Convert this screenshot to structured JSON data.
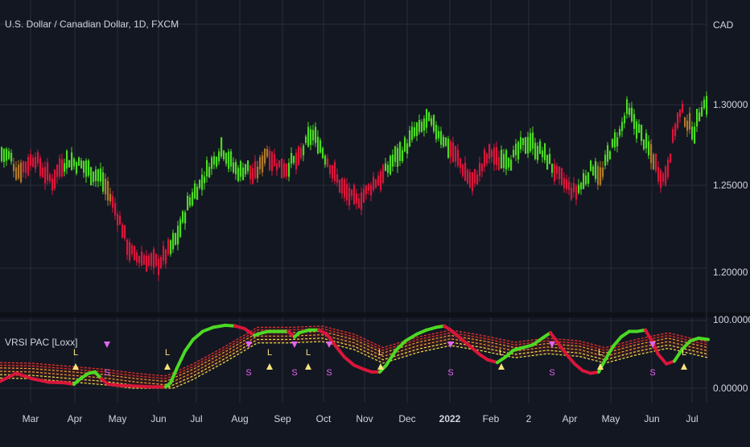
{
  "header": {
    "title": "U.S. Dollar / Canadian Dollar, 1D, FXCM",
    "indicator_name": "VRSI PAC [Loxx]",
    "currency_label": "CAD"
  },
  "colors": {
    "background": "#131722",
    "grid": "#2a2e39",
    "bull": "#4cd924",
    "bear": "#d9163a",
    "neutral": "#b07828",
    "band_upper": "#e3342f",
    "band_mid": "#f0a030",
    "band_lower": "#e6e64a",
    "buy_marker": "#f7e37a",
    "sell_marker": "#e066f0"
  },
  "chart_data": [
    {
      "type": "candlestick",
      "symbol": "USD/CAD",
      "interval": "1D",
      "y_ticks": [
        "1.30000",
        "1.25000",
        "1.20000"
      ],
      "ylim": [
        1.175,
        1.325
      ],
      "x_ticks": [
        "Mar",
        "Apr",
        "May",
        "Jun",
        "Jul",
        "Aug",
        "Sep",
        "Oct",
        "Nov",
        "Dec",
        "2022",
        "Feb",
        "2",
        "Apr",
        "May",
        "Jun",
        "Jul"
      ],
      "bold_x_ticks": [
        "2022"
      ],
      "price_path": [
        [
          0,
          1.27,
          "bull"
        ],
        [
          12,
          1.268,
          "bull"
        ],
        [
          20,
          1.259,
          "neutral"
        ],
        [
          32,
          1.263,
          "bear"
        ],
        [
          42,
          1.268,
          "bear"
        ],
        [
          52,
          1.26,
          "bear"
        ],
        [
          64,
          1.253,
          "bear"
        ],
        [
          74,
          1.263,
          "bear"
        ],
        [
          84,
          1.266,
          "bull"
        ],
        [
          94,
          1.264,
          "bull"
        ],
        [
          104,
          1.262,
          "bull"
        ],
        [
          114,
          1.258,
          "bull"
        ],
        [
          124,
          1.256,
          "bull"
        ],
        [
          134,
          1.246,
          "neutral"
        ],
        [
          142,
          1.236,
          "bear"
        ],
        [
          150,
          1.226,
          "bear"
        ],
        [
          158,
          1.213,
          "bear"
        ],
        [
          166,
          1.207,
          "bear"
        ],
        [
          176,
          1.206,
          "bear"
        ],
        [
          186,
          1.204,
          "bear"
        ],
        [
          196,
          1.203,
          "bear"
        ],
        [
          206,
          1.209,
          "bear"
        ],
        [
          216,
          1.216,
          "bull"
        ],
        [
          224,
          1.226,
          "bull"
        ],
        [
          232,
          1.238,
          "bull"
        ],
        [
          240,
          1.246,
          "bull"
        ],
        [
          250,
          1.253,
          "bull"
        ],
        [
          258,
          1.261,
          "bull"
        ],
        [
          266,
          1.266,
          "bull"
        ],
        [
          274,
          1.274,
          "bull"
        ],
        [
          282,
          1.268,
          "bull"
        ],
        [
          290,
          1.261,
          "bull"
        ],
        [
          298,
          1.259,
          "bull"
        ],
        [
          306,
          1.262,
          "bull"
        ],
        [
          314,
          1.256,
          "bear"
        ],
        [
          322,
          1.262,
          "neutral"
        ],
        [
          330,
          1.272,
          "neutral"
        ],
        [
          338,
          1.266,
          "bear"
        ],
        [
          346,
          1.263,
          "bear"
        ],
        [
          354,
          1.261,
          "bear"
        ],
        [
          362,
          1.265,
          "bull"
        ],
        [
          370,
          1.266,
          "bear"
        ],
        [
          378,
          1.275,
          "bull"
        ],
        [
          386,
          1.282,
          "bull"
        ],
        [
          394,
          1.278,
          "bull"
        ],
        [
          402,
          1.269,
          "bull"
        ],
        [
          410,
          1.262,
          "bear"
        ],
        [
          418,
          1.254,
          "bear"
        ],
        [
          426,
          1.248,
          "bear"
        ],
        [
          434,
          1.244,
          "bear"
        ],
        [
          442,
          1.241,
          "bear"
        ],
        [
          450,
          1.244,
          "bear"
        ],
        [
          458,
          1.249,
          "bear"
        ],
        [
          466,
          1.253,
          "bear"
        ],
        [
          474,
          1.256,
          "bear"
        ],
        [
          482,
          1.262,
          "bull"
        ],
        [
          490,
          1.268,
          "bull"
        ],
        [
          498,
          1.271,
          "bull"
        ],
        [
          506,
          1.276,
          "bull"
        ],
        [
          514,
          1.283,
          "bull"
        ],
        [
          522,
          1.285,
          "bull"
        ],
        [
          530,
          1.291,
          "bull"
        ],
        [
          538,
          1.286,
          "bull"
        ],
        [
          546,
          1.282,
          "bull"
        ],
        [
          554,
          1.276,
          "bull"
        ],
        [
          562,
          1.271,
          "bear"
        ],
        [
          570,
          1.265,
          "bear"
        ],
        [
          578,
          1.258,
          "bear"
        ],
        [
          586,
          1.252,
          "bear"
        ],
        [
          594,
          1.258,
          "bear"
        ],
        [
          602,
          1.266,
          "bear"
        ],
        [
          610,
          1.271,
          "bear"
        ],
        [
          618,
          1.265,
          "bear"
        ],
        [
          626,
          1.269,
          "bull"
        ],
        [
          634,
          1.266,
          "bull"
        ],
        [
          642,
          1.271,
          "bull"
        ],
        [
          650,
          1.276,
          "bull"
        ],
        [
          658,
          1.278,
          "bull"
        ],
        [
          666,
          1.273,
          "bull"
        ],
        [
          674,
          1.27,
          "bull"
        ],
        [
          682,
          1.265,
          "bull"
        ],
        [
          690,
          1.258,
          "bear"
        ],
        [
          698,
          1.253,
          "bear"
        ],
        [
          706,
          1.249,
          "bear"
        ],
        [
          714,
          1.246,
          "bear"
        ],
        [
          722,
          1.251,
          "bull"
        ],
        [
          730,
          1.258,
          "bull"
        ],
        [
          738,
          1.263,
          "bull"
        ],
        [
          746,
          1.254,
          "neutral"
        ],
        [
          754,
          1.269,
          "bull"
        ],
        [
          762,
          1.276,
          "bull"
        ],
        [
          770,
          1.283,
          "bull"
        ],
        [
          778,
          1.296,
          "bull"
        ],
        [
          786,
          1.291,
          "bull"
        ],
        [
          794,
          1.283,
          "bull"
        ],
        [
          802,
          1.275,
          "bull"
        ],
        [
          810,
          1.268,
          "neutral"
        ],
        [
          818,
          1.259,
          "bear"
        ],
        [
          824,
          1.254,
          "bear"
        ],
        [
          830,
          1.265,
          "bear"
        ],
        [
          838,
          1.286,
          "bear"
        ],
        [
          846,
          1.296,
          "bear"
        ],
        [
          854,
          1.288,
          "neutral"
        ],
        [
          862,
          1.284,
          "bull"
        ],
        [
          870,
          1.298,
          "bull"
        ],
        [
          878,
          1.302,
          "bull"
        ]
      ]
    },
    {
      "type": "line",
      "name": "VRSI PAC [Loxx]",
      "y_ticks": [
        "100.00000",
        "0.00000"
      ],
      "ylim": [
        0,
        100
      ],
      "vrsi": [
        [
          0,
          10,
          "bear"
        ],
        [
          20,
          22,
          "bear"
        ],
        [
          40,
          14,
          "bear"
        ],
        [
          60,
          9,
          "bear"
        ],
        [
          80,
          8,
          "bear"
        ],
        [
          92,
          6,
          "bear"
        ],
        [
          100,
          14,
          "bull"
        ],
        [
          110,
          22,
          "bull"
        ],
        [
          118,
          24,
          "bull"
        ],
        [
          126,
          14,
          "bull"
        ],
        [
          134,
          6,
          "bear"
        ],
        [
          150,
          4,
          "bear"
        ],
        [
          170,
          3,
          "bear"
        ],
        [
          190,
          2,
          "bear"
        ],
        [
          206,
          2,
          "bear"
        ],
        [
          212,
          8,
          "bull"
        ],
        [
          220,
          30,
          "bull"
        ],
        [
          230,
          55,
          "bull"
        ],
        [
          240,
          72,
          "bull"
        ],
        [
          252,
          84,
          "bull"
        ],
        [
          265,
          90,
          "bull"
        ],
        [
          280,
          93,
          "bull"
        ],
        [
          292,
          92,
          "bull"
        ],
        [
          304,
          88,
          "bear"
        ],
        [
          316,
          78,
          "bear"
        ],
        [
          326,
          82,
          "bull"
        ],
        [
          334,
          84,
          "bull"
        ],
        [
          346,
          84,
          "bull"
        ],
        [
          358,
          84,
          "bull"
        ],
        [
          366,
          76,
          "bear"
        ],
        [
          372,
          82,
          "bull"
        ],
        [
          384,
          86,
          "bull"
        ],
        [
          396,
          86,
          "bull"
        ],
        [
          406,
          80,
          "bear"
        ],
        [
          416,
          64,
          "bear"
        ],
        [
          428,
          46,
          "bear"
        ],
        [
          440,
          34,
          "bear"
        ],
        [
          452,
          28,
          "bear"
        ],
        [
          462,
          24,
          "bear"
        ],
        [
          472,
          24,
          "bear"
        ],
        [
          480,
          34,
          "bull"
        ],
        [
          492,
          56,
          "bull"
        ],
        [
          504,
          70,
          "bull"
        ],
        [
          518,
          80,
          "bull"
        ],
        [
          530,
          86,
          "bull"
        ],
        [
          542,
          90,
          "bull"
        ],
        [
          552,
          92,
          "bull"
        ],
        [
          560,
          86,
          "bear"
        ],
        [
          572,
          74,
          "bear"
        ],
        [
          584,
          62,
          "bear"
        ],
        [
          596,
          50,
          "bear"
        ],
        [
          606,
          42,
          "bear"
        ],
        [
          618,
          38,
          "bear"
        ],
        [
          628,
          46,
          "bull"
        ],
        [
          638,
          56,
          "bull"
        ],
        [
          650,
          60,
          "bull"
        ],
        [
          662,
          64,
          "bull"
        ],
        [
          674,
          74,
          "bull"
        ],
        [
          684,
          82,
          "bull"
        ],
        [
          694,
          66,
          "bear"
        ],
        [
          704,
          50,
          "bear"
        ],
        [
          714,
          36,
          "bear"
        ],
        [
          724,
          26,
          "bear"
        ],
        [
          734,
          22,
          "bear"
        ],
        [
          744,
          24,
          "bear"
        ],
        [
          752,
          42,
          "bull"
        ],
        [
          762,
          62,
          "bull"
        ],
        [
          772,
          76,
          "bull"
        ],
        [
          782,
          84,
          "bull"
        ],
        [
          792,
          84,
          "bull"
        ],
        [
          802,
          86,
          "bull"
        ],
        [
          810,
          70,
          "bear"
        ],
        [
          818,
          50,
          "bear"
        ],
        [
          828,
          36,
          "bear"
        ],
        [
          838,
          40,
          "bear"
        ],
        [
          848,
          58,
          "bull"
        ],
        [
          858,
          70,
          "bull"
        ],
        [
          868,
          74,
          "bull"
        ],
        [
          880,
          72,
          "bull"
        ]
      ],
      "band_center": [
        [
          0,
          28
        ],
        [
          40,
          27
        ],
        [
          90,
          22
        ],
        [
          130,
          18
        ],
        [
          170,
          12
        ],
        [
          206,
          8
        ],
        [
          240,
          26
        ],
        [
          280,
          52
        ],
        [
          320,
          80
        ],
        [
          360,
          80
        ],
        [
          400,
          82
        ],
        [
          440,
          70
        ],
        [
          476,
          50
        ],
        [
          520,
          66
        ],
        [
          560,
          76
        ],
        [
          600,
          68
        ],
        [
          640,
          58
        ],
        [
          680,
          64
        ],
        [
          720,
          60
        ],
        [
          752,
          50
        ],
        [
          790,
          62
        ],
        [
          830,
          72
        ],
        [
          880,
          58
        ]
      ],
      "signals": [
        {
          "x": 94,
          "kind": "L",
          "label": "L"
        },
        {
          "x": 133,
          "kind": "S",
          "label": "S"
        },
        {
          "x": 208,
          "kind": "L",
          "label": "L"
        },
        {
          "x": 309,
          "kind": "S",
          "label": "S"
        },
        {
          "x": 335,
          "kind": "L",
          "label": "L"
        },
        {
          "x": 366,
          "kind": "S",
          "label": "S"
        },
        {
          "x": 383,
          "kind": "L",
          "label": "L"
        },
        {
          "x": 409,
          "kind": "S",
          "label": "S"
        },
        {
          "x": 473,
          "kind": "L",
          "label": "L"
        },
        {
          "x": 560,
          "kind": "S",
          "label": "S"
        },
        {
          "x": 623,
          "kind": "L",
          "label": "L"
        },
        {
          "x": 686,
          "kind": "S",
          "label": "S"
        },
        {
          "x": 746,
          "kind": "L",
          "label": "L"
        },
        {
          "x": 811,
          "kind": "S",
          "label": "S"
        },
        {
          "x": 850,
          "kind": "L",
          "label": "L"
        }
      ]
    }
  ]
}
